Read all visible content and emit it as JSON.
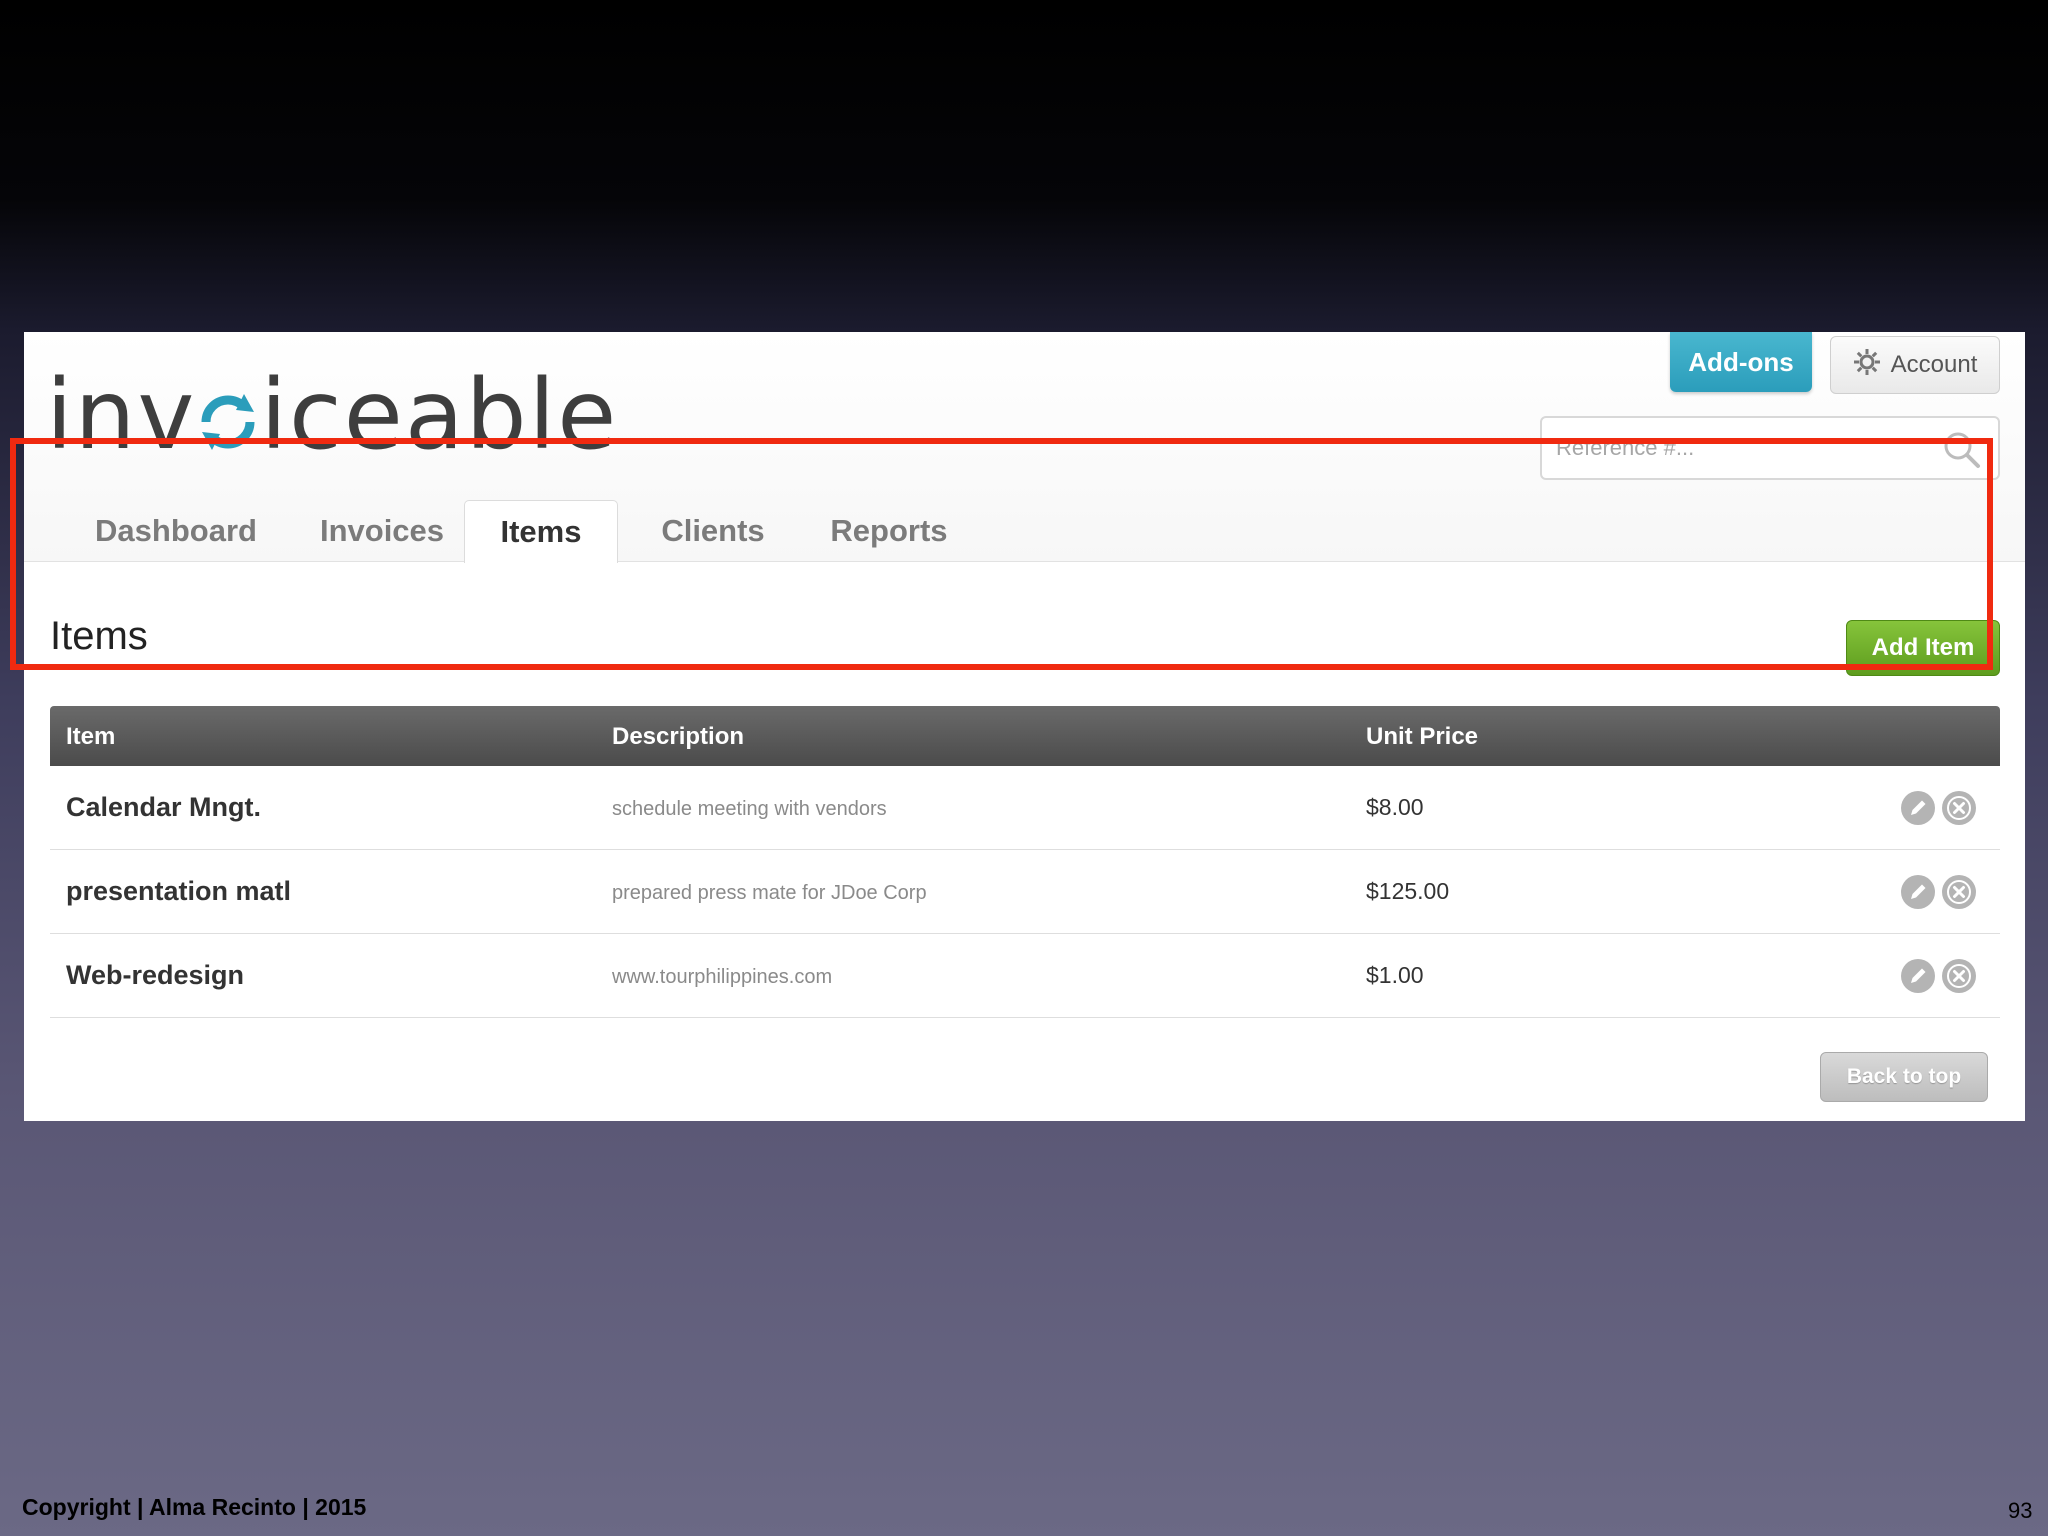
{
  "app": {
    "logo_text_prefix": "inv",
    "logo_text_suffix": "iceable",
    "brand_color": "#2b9dbb"
  },
  "header": {
    "addons_label": "Add-ons",
    "account_label": "Account",
    "search_placeholder": "Reference #..."
  },
  "nav": {
    "tabs": [
      {
        "label": "Dashboard",
        "active": false
      },
      {
        "label": "Invoices",
        "active": false
      },
      {
        "label": "Items",
        "active": true
      },
      {
        "label": "Clients",
        "active": false
      },
      {
        "label": "Reports",
        "active": false
      }
    ]
  },
  "main": {
    "title": "Items",
    "add_item_label": "Add Item",
    "back_to_top_label": "Back to top"
  },
  "table": {
    "columns": [
      "Item",
      "Description",
      "Unit Price"
    ],
    "rows": [
      {
        "item": "Calendar Mngt.",
        "description": "schedule meeting with vendors",
        "price": "$8.00"
      },
      {
        "item": "presentation matl",
        "description": "prepared press mate for JDoe Corp",
        "price": "$125.00"
      },
      {
        "item": "Web-redesign",
        "description": "www.tourphilippines.com",
        "price": "$1.00"
      }
    ]
  },
  "slide": {
    "copyright": "Copyright | Alma Recinto | 2015",
    "number": "93",
    "highlight_color": "#f02a10"
  }
}
